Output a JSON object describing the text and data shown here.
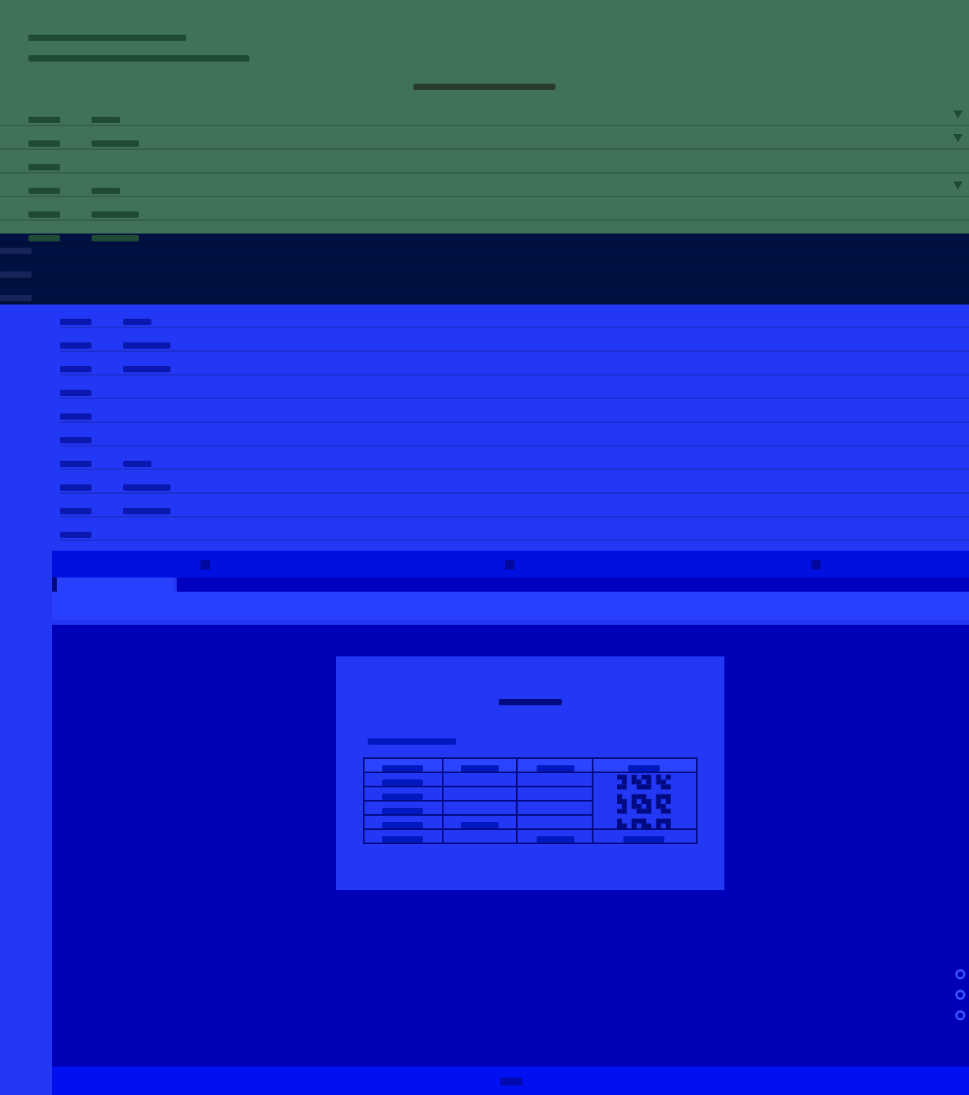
{
  "upper_form": {
    "rows": [
      {
        "kind": "dropdown",
        "has_value": true
      },
      {
        "kind": "dropdown",
        "has_value": true
      },
      {
        "kind": "plain",
        "has_value": false
      },
      {
        "kind": "dropdown",
        "has_value": true
      },
      {
        "kind": "plain",
        "has_value": true
      },
      {
        "kind": "plain",
        "has_value": true
      },
      {
        "kind": "plain",
        "has_value": false
      },
      {
        "kind": "plain",
        "has_value": false
      },
      {
        "kind": "plain",
        "has_value": false
      },
      {
        "kind": "plain",
        "has_value": true
      },
      {
        "kind": "plain",
        "has_value": true
      },
      {
        "kind": "plain",
        "has_value": true
      },
      {
        "kind": "plain",
        "has_value": false
      },
      {
        "kind": "plain",
        "has_value": false
      },
      {
        "kind": "plain",
        "has_value": false
      },
      {
        "kind": "plain",
        "has_value": true
      },
      {
        "kind": "plain",
        "has_value": true
      },
      {
        "kind": "plain",
        "has_value": true
      },
      {
        "kind": "plain",
        "has_value": false
      }
    ]
  },
  "preview": {
    "table_rows": [
      {
        "kind": "header"
      },
      {
        "kind": "body"
      },
      {
        "kind": "body"
      },
      {
        "kind": "body"
      },
      {
        "kind": "body"
      },
      {
        "kind": "footer"
      }
    ],
    "qr_code": true
  }
}
